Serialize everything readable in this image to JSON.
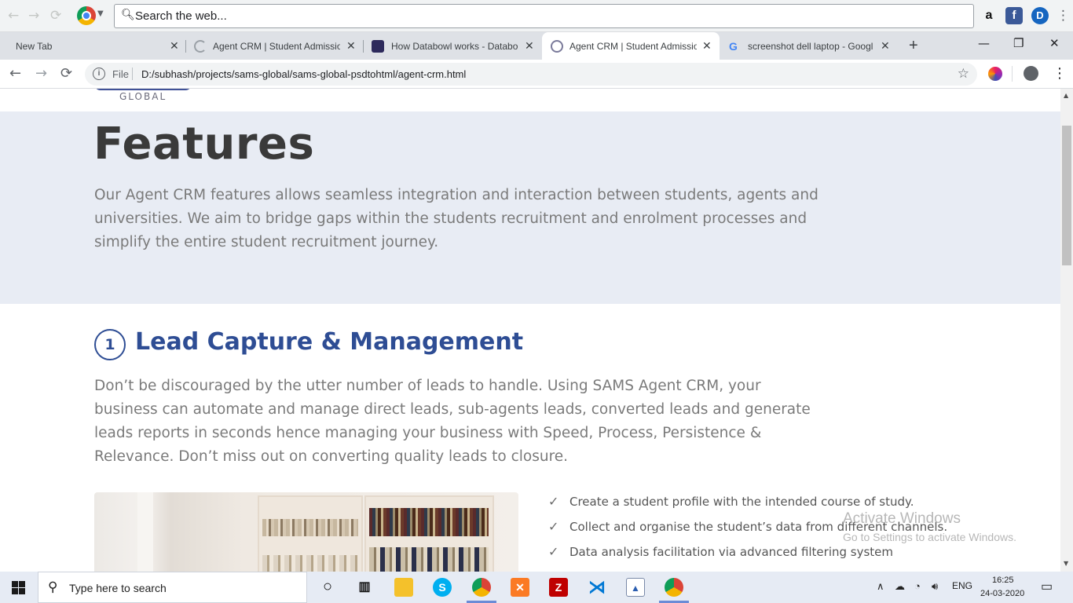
{
  "top_bar": {
    "search_placeholder": "Search the web...",
    "icons": [
      "back-icon",
      "forward-icon",
      "reload-icon",
      "chrome-logo-icon",
      "search-icon",
      "amazon-icon",
      "facebook-icon",
      "d-extension-icon",
      "menu-icon"
    ]
  },
  "tabs": [
    {
      "label": "New Tab",
      "active": false
    },
    {
      "label": "Agent CRM | Student Admissio",
      "active": false,
      "loading": true
    },
    {
      "label": "How Databowl works - Databo",
      "active": false
    },
    {
      "label": "Agent CRM | Student Admissio",
      "active": true
    },
    {
      "label": "screenshot dell laptop - Googl",
      "active": false
    }
  ],
  "tab_close_glyph": "✕",
  "new_tab_glyph": "+",
  "window_controls": {
    "minimize": "—",
    "maximize": "❐",
    "close": "✕"
  },
  "address_bar": {
    "scheme_label": "File",
    "url": "D:/subhash/projects/sams-global/sams-global-psdtohtml/agent-crm.html"
  },
  "page": {
    "logo_text": "GLOBAL",
    "features": {
      "title": "Features",
      "description": "Our Agent CRM features allows seamless integration and interaction between students, agents and universities. We aim to bridge gaps within the students recruitment and enrolment processes and simplify the entire student recruitment journey."
    },
    "lead": {
      "number": "1",
      "title": "Lead Capture & Management",
      "description": "Don’t be discouraged by the utter number of leads to handle. Using SAMS Agent CRM, your business can automate and manage direct leads, sub-agents leads, converted leads and generate leads reports in seconds hence managing your business with Speed, Process, Persistence & Relevance. Don’t miss out on converting quality leads to closure.",
      "checklist": [
        "Create a student profile with the intended course of study.",
        "Collect and organise the student’s data from different channels.",
        "Data analysis facilitation via advanced filtering system"
      ]
    },
    "watermark": {
      "line1": "Activate Windows",
      "line2": "Go to Settings to activate Windows."
    }
  },
  "taskbar": {
    "search_placeholder": "Type here to search",
    "apps": [
      "cortana-icon",
      "task-view-icon",
      "file-explorer-icon",
      "skype-icon",
      "chrome-icon",
      "xampp-icon",
      "filezilla-icon",
      "vscode-icon",
      "image-viewer-icon",
      "chrome-icon-2"
    ],
    "language": "ENG",
    "time": "16:25",
    "date": "24-03-2020"
  },
  "colors": {
    "brand_blue": "#2e4d94",
    "features_band": "#e8ecf4",
    "body_text": "#7a7a7a",
    "heading_text": "#3a3a3a"
  }
}
